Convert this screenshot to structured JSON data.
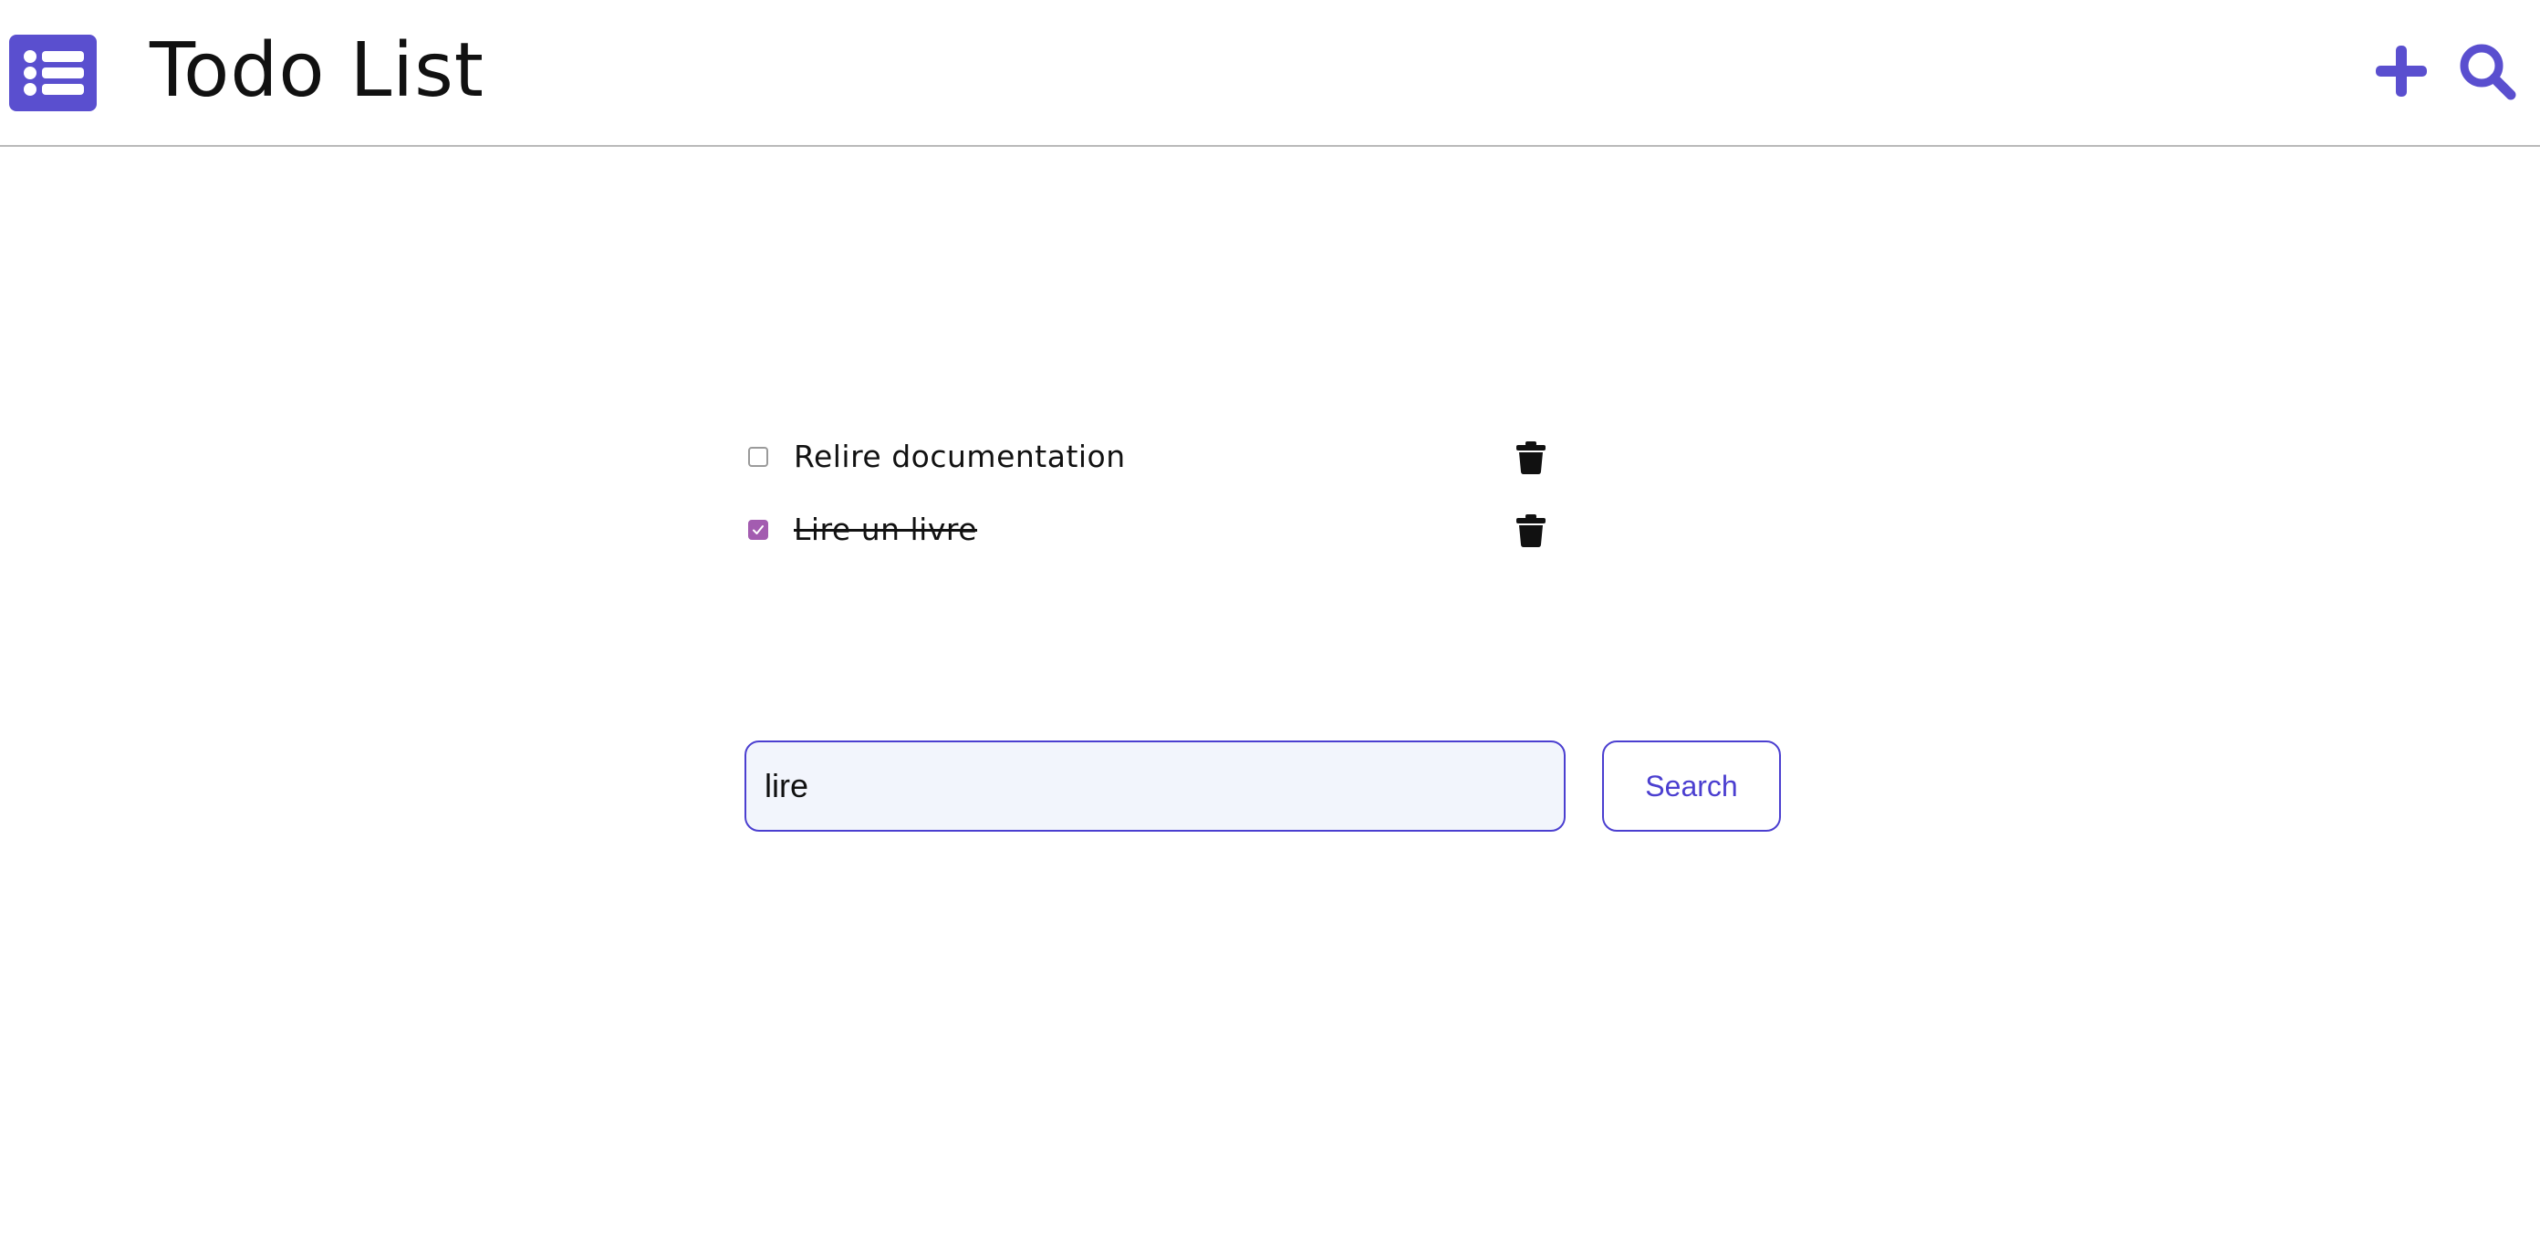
{
  "header": {
    "logo_icon": "list-icon",
    "title": "Todo List",
    "add_icon": "plus-icon",
    "search_icon": "search-icon"
  },
  "todos": [
    {
      "text": "Relire documentation",
      "done": false,
      "delete_icon": "trash-icon"
    },
    {
      "text": "Lire un livre",
      "done": true,
      "delete_icon": "trash-icon"
    }
  ],
  "search": {
    "value": "lire",
    "button_label": "Search"
  },
  "colors": {
    "accent": "#5a4fcf",
    "checkbox_checked": "#a35cb0",
    "input_border": "#4b3fd0",
    "input_background": "#f2f5fc"
  }
}
